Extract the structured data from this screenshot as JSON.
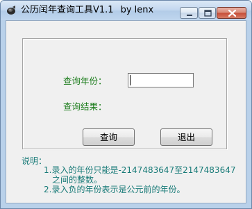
{
  "window": {
    "title": "公历闰年查询工具V1.1",
    "author": "by lenx"
  },
  "form": {
    "year_label": "查询年份：",
    "year_value": "",
    "result_label": "查询结果：",
    "query_button": "查询",
    "exit_button": "退出"
  },
  "notes": {
    "title": "说明：",
    "line1": "1.录入的年份只能是-2147483647至2147483647",
    "line1_cont": "之间的整数。",
    "line2": "2.录入负的年份表示是公元前的年份。"
  },
  "colors": {
    "label_green": "#177a17",
    "note_teal": "#177a77",
    "dialog_bg": "#f0f0f0",
    "frame_blue": "#b9d1ea",
    "close_red": "#c8503a"
  },
  "icons": {
    "app": "speaker-icon",
    "minimize": "minimize-icon",
    "maximize": "maximize-icon",
    "close": "close-icon"
  }
}
